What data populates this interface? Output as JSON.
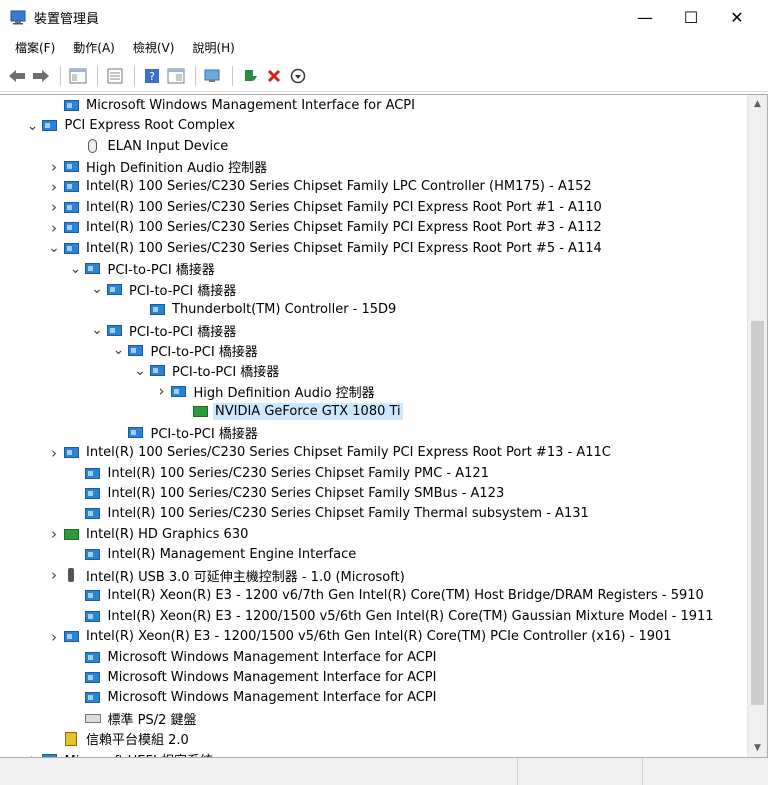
{
  "window": {
    "title": "裝置管理員",
    "min": "—",
    "max": "☐",
    "close": "✕"
  },
  "menu": [
    "檔案(F)",
    "動作(A)",
    "檢視(V)",
    "說明(H)"
  ],
  "toolbar": {
    "buttons": [
      "back",
      "forward",
      "show-hide-console-tree",
      "properties",
      "help",
      "view",
      "scan-hardware",
      "update-driver",
      "uninstall",
      "disable"
    ]
  },
  "tree": [
    {
      "indent": 4,
      "arrow": "",
      "icon": "dev",
      "label": "Microsoft Windows Management Interface for ACPI"
    },
    {
      "indent": 3,
      "arrow": "expanded",
      "icon": "dev",
      "label": "PCI Express Root Complex"
    },
    {
      "indent": 5,
      "arrow": "",
      "icon": "mouse",
      "label": "ELAN Input Device"
    },
    {
      "indent": 4,
      "arrow": "collapsed",
      "icon": "dev",
      "label": "High Definition Audio 控制器"
    },
    {
      "indent": 4,
      "arrow": "collapsed",
      "icon": "dev",
      "label": "Intel(R) 100 Series/C230 Series Chipset Family LPC Controller (HM175) - A152"
    },
    {
      "indent": 4,
      "arrow": "collapsed",
      "icon": "dev",
      "label": "Intel(R) 100 Series/C230 Series Chipset Family PCI Express Root Port #1 - A110"
    },
    {
      "indent": 4,
      "arrow": "collapsed",
      "icon": "dev",
      "label": "Intel(R) 100 Series/C230 Series Chipset Family PCI Express Root Port #3 - A112"
    },
    {
      "indent": 4,
      "arrow": "expanded",
      "icon": "dev",
      "label": "Intel(R) 100 Series/C230 Series Chipset Family PCI Express Root Port #5 - A114"
    },
    {
      "indent": 5,
      "arrow": "expanded",
      "icon": "dev",
      "label": "PCI-to-PCI 橋接器"
    },
    {
      "indent": 6,
      "arrow": "expanded",
      "icon": "dev",
      "label": "PCI-to-PCI 橋接器"
    },
    {
      "indent": 8,
      "arrow": "",
      "icon": "dev",
      "label": "Thunderbolt(TM) Controller - 15D9"
    },
    {
      "indent": 6,
      "arrow": "expanded",
      "icon": "dev",
      "label": "PCI-to-PCI 橋接器"
    },
    {
      "indent": 7,
      "arrow": "expanded",
      "icon": "dev",
      "label": "PCI-to-PCI 橋接器"
    },
    {
      "indent": 8,
      "arrow": "expanded",
      "icon": "dev",
      "label": "PCI-to-PCI 橋接器"
    },
    {
      "indent": 9,
      "arrow": "collapsed",
      "icon": "dev",
      "label": "High Definition Audio 控制器"
    },
    {
      "indent": 10,
      "arrow": "",
      "icon": "gpu",
      "label": "NVIDIA GeForce GTX 1080 Ti",
      "selected": true
    },
    {
      "indent": 7,
      "arrow": "",
      "icon": "dev",
      "label": "PCI-to-PCI 橋接器"
    },
    {
      "indent": 4,
      "arrow": "collapsed",
      "icon": "dev",
      "label": "Intel(R) 100 Series/C230 Series Chipset Family PCI Express Root Port #13 - A11C"
    },
    {
      "indent": 5,
      "arrow": "",
      "icon": "dev",
      "label": "Intel(R) 100 Series/C230 Series Chipset Family PMC - A121"
    },
    {
      "indent": 5,
      "arrow": "",
      "icon": "dev",
      "label": "Intel(R) 100 Series/C230 Series Chipset Family SMBus - A123"
    },
    {
      "indent": 5,
      "arrow": "",
      "icon": "dev",
      "label": "Intel(R) 100 Series/C230 Series Chipset Family Thermal subsystem - A131"
    },
    {
      "indent": 4,
      "arrow": "collapsed",
      "icon": "gpu",
      "label": "Intel(R) HD Graphics 630"
    },
    {
      "indent": 5,
      "arrow": "",
      "icon": "dev",
      "label": "Intel(R) Management Engine Interface"
    },
    {
      "indent": 4,
      "arrow": "collapsed",
      "icon": "usb",
      "label": "Intel(R) USB 3.0 可延伸主機控制器 - 1.0 (Microsoft)"
    },
    {
      "indent": 5,
      "arrow": "",
      "icon": "dev",
      "label": "Intel(R) Xeon(R) E3 - 1200 v6/7th Gen Intel(R) Core(TM) Host Bridge/DRAM Registers - 5910"
    },
    {
      "indent": 5,
      "arrow": "",
      "icon": "dev",
      "label": "Intel(R) Xeon(R) E3 - 1200/1500 v5/6th Gen Intel(R) Core(TM) Gaussian Mixture Model - 1911"
    },
    {
      "indent": 4,
      "arrow": "collapsed",
      "icon": "dev",
      "label": "Intel(R) Xeon(R) E3 - 1200/1500 v5/6th Gen Intel(R) Core(TM) PCIe Controller (x16) - 1901"
    },
    {
      "indent": 5,
      "arrow": "",
      "icon": "dev",
      "label": "Microsoft Windows Management Interface for ACPI"
    },
    {
      "indent": 5,
      "arrow": "",
      "icon": "dev",
      "label": "Microsoft Windows Management Interface for ACPI"
    },
    {
      "indent": 5,
      "arrow": "",
      "icon": "dev",
      "label": "Microsoft Windows Management Interface for ACPI"
    },
    {
      "indent": 5,
      "arrow": "",
      "icon": "kbd",
      "label": "標準 PS/2 鍵盤"
    },
    {
      "indent": 4,
      "arrow": "",
      "icon": "tpm",
      "label": "信賴平台模組 2.0"
    },
    {
      "indent": 3,
      "arrow": "collapsed",
      "icon": "dev",
      "label": "Microsoft UEFI 相容系統"
    }
  ],
  "colors": {
    "selection": "#cce8ff",
    "accent": "#2b83d6"
  }
}
